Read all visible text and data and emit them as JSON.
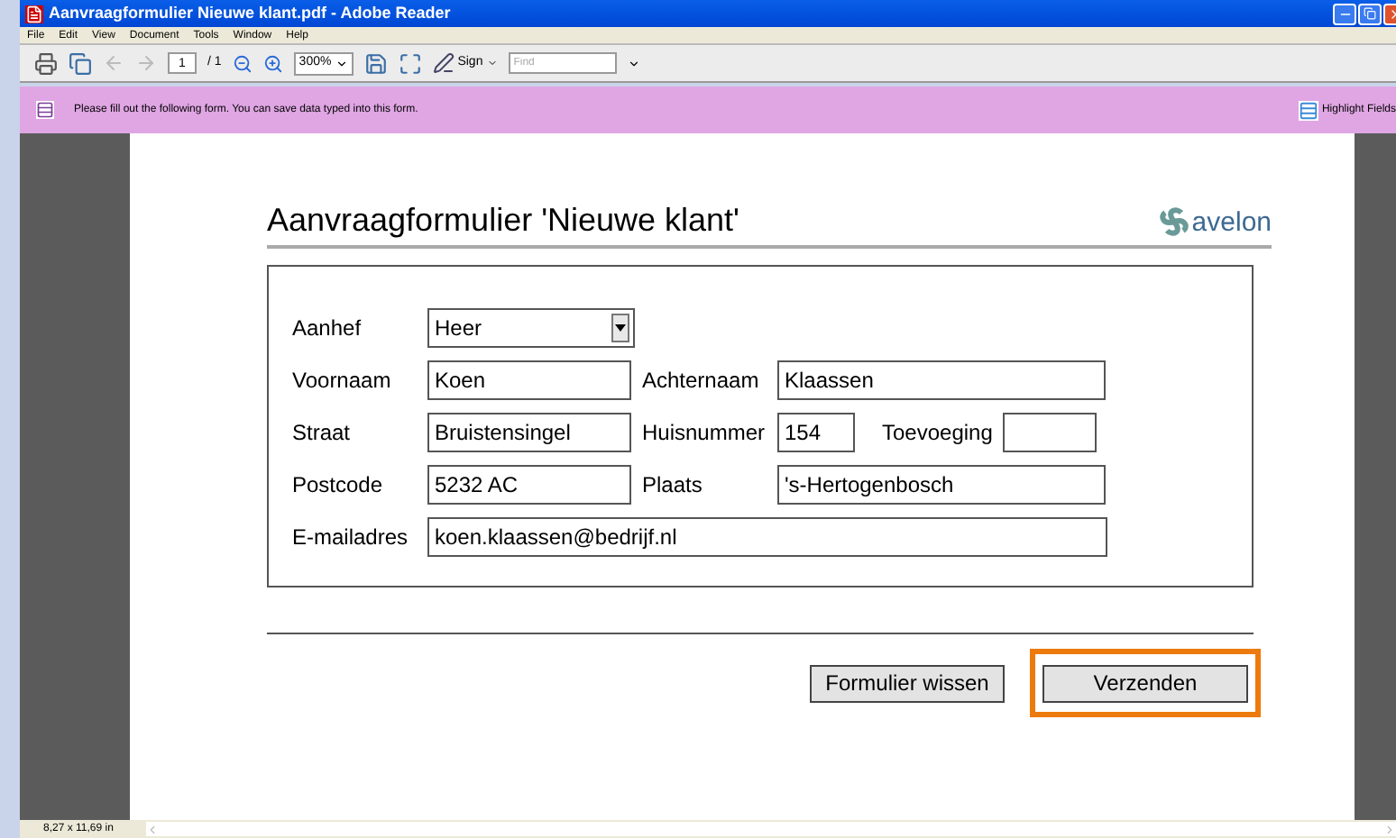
{
  "window": {
    "title": "Aanvraagformulier Nieuwe klant.pdf - Adobe Reader"
  },
  "menu": [
    "File",
    "Edit",
    "View",
    "Document",
    "Tools",
    "Window",
    "Help"
  ],
  "toolbar": {
    "page": "1",
    "page_total": "/ 1",
    "zoom": "300%",
    "sign": "Sign",
    "find_placeholder": "Find"
  },
  "notice_bar": {
    "message": "Please fill out the following form. You can save data typed into this form.",
    "button": "Highlight Fields"
  },
  "document": {
    "title": "Aanvraagformulier 'Nieuwe klant'",
    "logo": "avelon",
    "rows": [
      [
        {
          "label": "Aanhef",
          "value": "Heer",
          "kind": "select"
        }
      ],
      [
        {
          "label": "Voornaam",
          "value": "Koen",
          "kind": "text"
        },
        {
          "label": "Achternaam",
          "value": "Klaassen",
          "kind": "text"
        }
      ],
      [
        {
          "label": "Straat",
          "value": "Bruistensingel",
          "kind": "text"
        },
        {
          "label": "Huisnummer",
          "value": "154",
          "kind": "text"
        },
        {
          "label": "Toevoeging",
          "kind": "text"
        }
      ],
      [
        {
          "label": "Postcode",
          "value": "5232 AC",
          "kind": "text"
        },
        {
          "label": "Plaats",
          "value": "'s-Hertogenbosch",
          "kind": "text"
        }
      ],
      [
        {
          "label": "E-mailadres",
          "value": "koen.klaassen@bedrijf.nl",
          "kind": "text"
        }
      ]
    ],
    "buttons": [
      {
        "label": "Formulier wissen",
        "highlighted": false
      },
      {
        "label": "Verzenden",
        "highlighted": true
      }
    ]
  },
  "status_bar": {
    "page_size": "8,27 x 11,69 in"
  }
}
